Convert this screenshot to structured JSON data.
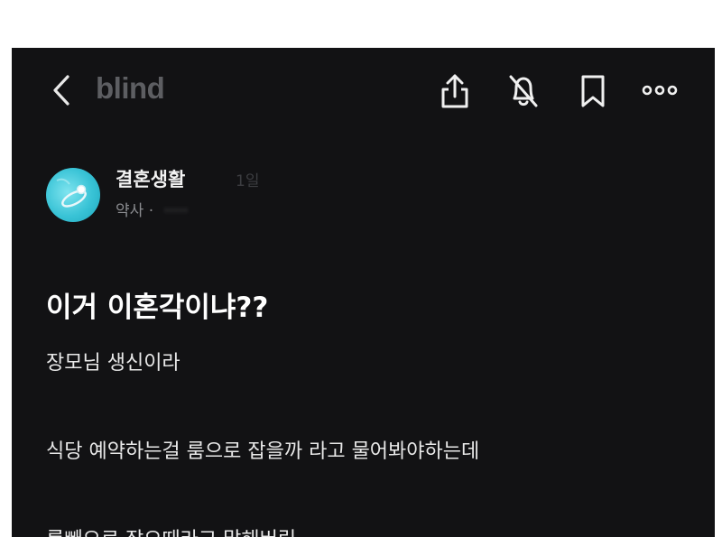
{
  "header": {
    "brand": "blind",
    "icons": {
      "back": "chevron-left-icon",
      "share": "share-icon",
      "bell": "bell-off-icon",
      "bookmark": "bookmark-icon",
      "more": "more-horizontal-icon"
    }
  },
  "author": {
    "name": "결혼생활",
    "time": "1일",
    "job": "약사",
    "separator": "·",
    "company_obscured": "·····"
  },
  "post": {
    "title": "이거 이혼각이냐??",
    "lines": [
      "장모님 생신이라",
      "식당 예약하는걸 룸으로 잡을까 라고 물어봐야하는데",
      "룸빼으로 잡으때라고 말해버림"
    ]
  },
  "colors": {
    "background": "#121214",
    "brand": "#5d5e62",
    "text": "#ffffff",
    "muted": "#8a8b8f",
    "avatar": "#39c3d6"
  }
}
